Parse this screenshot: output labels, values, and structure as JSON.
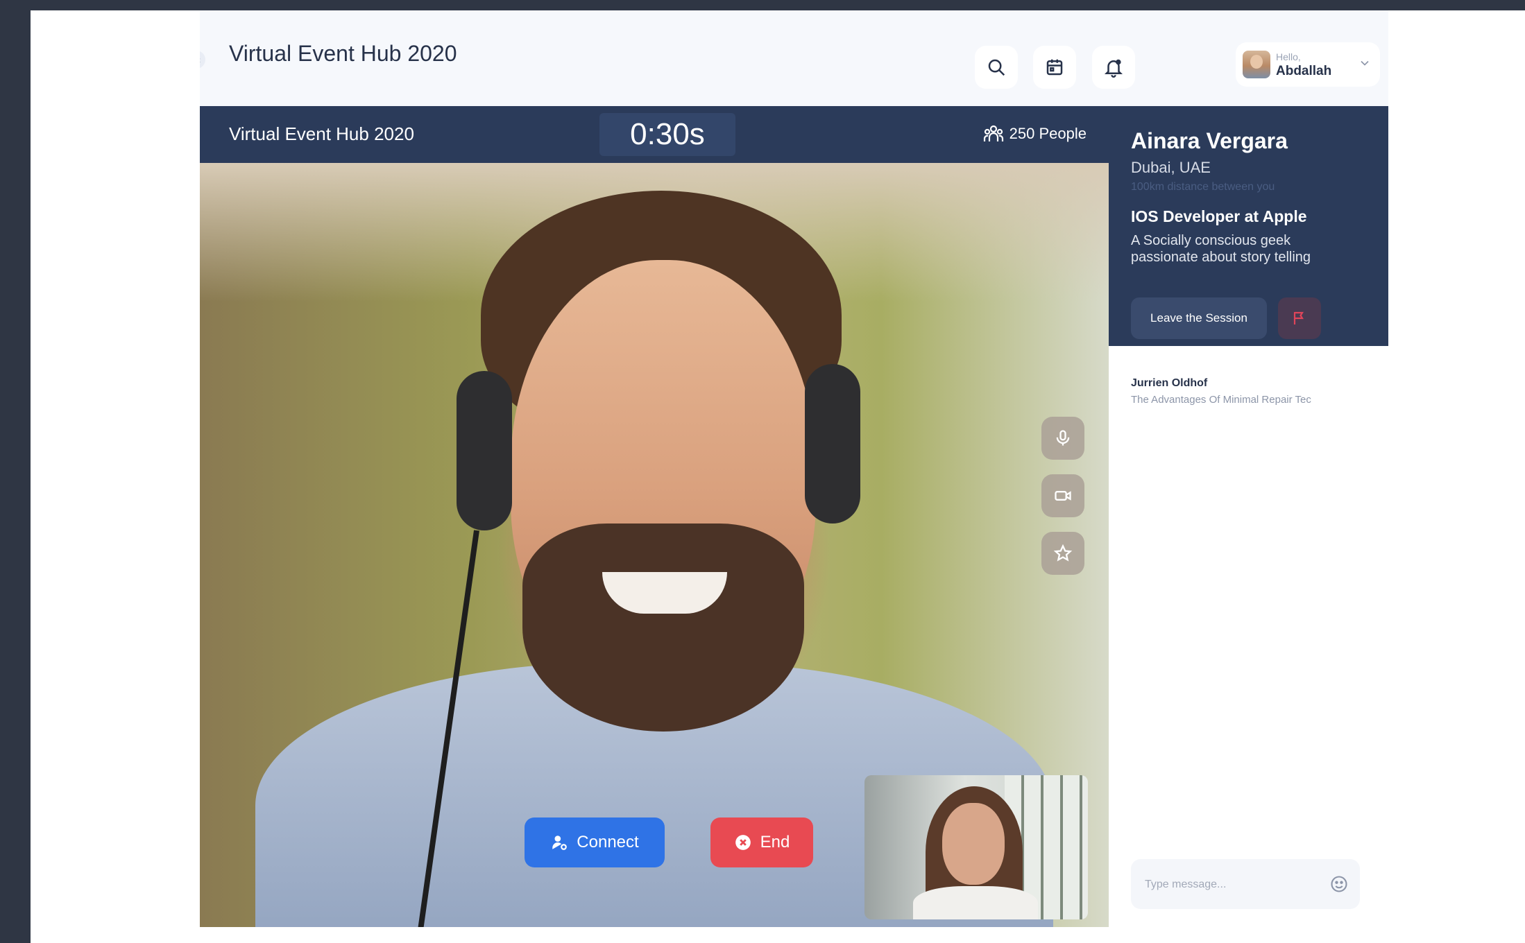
{
  "header": {
    "title": "Virtual Event Hub 2020",
    "user": {
      "greeting": "Hello,",
      "name": "Abdallah"
    },
    "icons": [
      "search-icon",
      "calendar-icon",
      "bell-icon",
      "chevron-down-icon"
    ]
  },
  "session": {
    "title": "Virtual Event Hub 2020",
    "timer": "0:30s",
    "people": "250 People"
  },
  "controls": {
    "connect_label": "Connect",
    "end_label": "End",
    "side_icons": [
      "microphone-icon",
      "video-camera-icon",
      "star-icon"
    ]
  },
  "profile": {
    "name": "Ainara Vergara",
    "location": "Dubai, UAE",
    "distance": "100km distance between you",
    "role": "IOS Developer at Apple",
    "bio": "A Socially conscious geek passionate about story telling",
    "leave_label": "Leave the Session"
  },
  "chat": {
    "messages": [
      {
        "name": "Jurrien Oldhof",
        "text": "The Advantages Of Minimal Repair Tec"
      }
    ],
    "placeholder": "Type message..."
  },
  "colors": {
    "navy": "#2b3b5a",
    "connect": "#2f73e6",
    "end": "#e84a52",
    "flag": "#e0455a"
  }
}
